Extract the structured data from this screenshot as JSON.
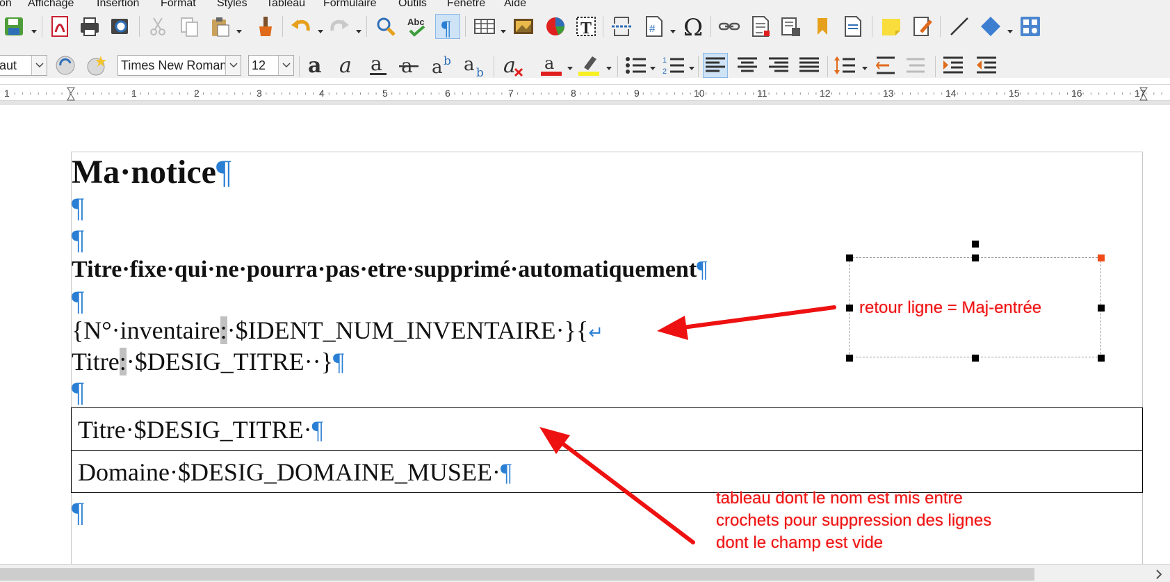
{
  "menu": {
    "items": [
      "on",
      "Affichage",
      "Insertion",
      "Format",
      "Styles",
      "Tableau",
      "Formulaire",
      "Outils",
      "Fenêtre",
      "Aide"
    ]
  },
  "formatting": {
    "paragraph_style": "aut",
    "font_name": "Times New Roman",
    "font_size": "12"
  },
  "ruler": {
    "numbers": [
      "1",
      "1",
      "2",
      "3",
      "4",
      "5",
      "6",
      "7",
      "8",
      "9",
      "10",
      "11",
      "12",
      "13",
      "14",
      "15",
      "16",
      "17"
    ]
  },
  "document": {
    "title": "Ma·notice",
    "fixed_title": "Titre·fixe·qui·ne·pourra·pas·etre·supprimé·automatiquement",
    "inventory_line": {
      "prefix": "{N°·inventaire",
      "field": "·$IDENT_NUM_INVENTAIRE·}{"
    },
    "title_line": {
      "prefix": "Titre",
      "field": "·$DESIG_TITRE··}"
    },
    "table_rows": [
      {
        "label": "Titre·$DESIG_TITRE·"
      },
      {
        "label": "Domaine·$DESIG_DOMAINE_MUSEE·"
      }
    ],
    "pilcrow": "¶",
    "line_break": "↵"
  },
  "annotations": {
    "frame_note": "retour ligne = Maj-entrée",
    "table_note": [
      "tableau dont le nom est mis entre",
      "crochets pour suppression des lignes",
      "dont le champ est vide"
    ],
    "color": "#ee1111"
  },
  "colors": {
    "formatting_marks": "#2a7fd4",
    "toolbar_bg": "#f0f0f0"
  },
  "icons": {
    "toolbar1": [
      "save-icon",
      "export-pdf-icon",
      "print-icon",
      "print-preview-icon",
      "cut-icon",
      "copy-icon",
      "paste-icon",
      "clone-formatting-icon",
      "undo-icon",
      "redo-icon",
      "find-replace-icon",
      "spellcheck-icon",
      "formatting-marks-icon",
      "insert-table-icon",
      "insert-image-icon",
      "insert-chart-icon",
      "insert-textbox-icon",
      "page-break-icon",
      "insert-field-icon",
      "special-character-icon",
      "hyperlink-icon",
      "footnote-icon",
      "endnote-icon",
      "bookmark-icon",
      "cross-reference-icon",
      "comment-icon",
      "track-changes-icon",
      "line-icon",
      "shapes-icon",
      "draw-functions-icon"
    ],
    "toolbar2": [
      "update-style-icon",
      "new-style-icon",
      "bold-icon",
      "italic-icon",
      "underline-icon",
      "strikethrough-icon",
      "superscript-icon",
      "subscript-icon",
      "clear-formatting-icon",
      "font-color-icon",
      "highlight-icon",
      "bullet-list-icon",
      "numbered-list-icon",
      "align-left-icon",
      "align-center-icon",
      "align-right-icon",
      "justify-icon",
      "line-spacing-icon",
      "increase-spacing-icon",
      "decrease-spacing-icon",
      "increase-indent-icon",
      "decrease-indent-icon"
    ]
  }
}
